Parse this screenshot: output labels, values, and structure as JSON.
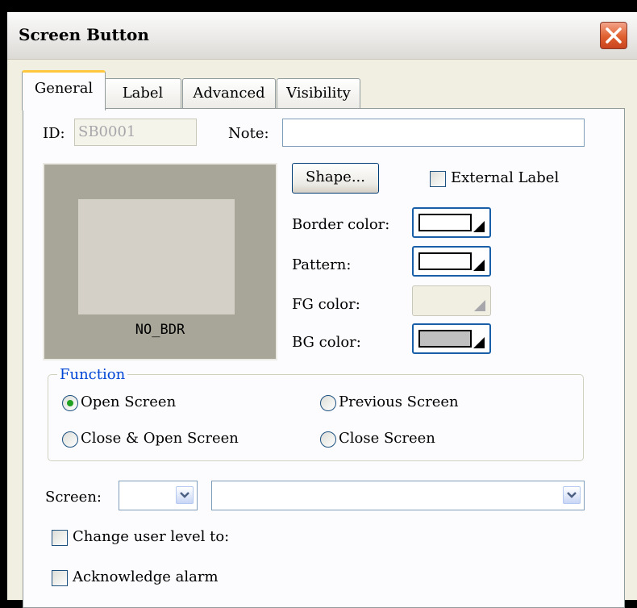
{
  "window": {
    "title": "Screen Button"
  },
  "tabs": [
    {
      "label": "General",
      "active": true
    },
    {
      "label": "Label",
      "active": false
    },
    {
      "label": "Advanced",
      "active": false
    },
    {
      "label": "Visibility",
      "active": false
    }
  ],
  "general": {
    "id_label": "ID:",
    "id_value": "SB0001",
    "note_label": "Note:",
    "note_value": "",
    "preview_label": "NO_BDR",
    "shape_button": "Shape...",
    "external_label": "External Label",
    "external_label_checked": false,
    "border_color_label": "Border color:",
    "pattern_label": "Pattern:",
    "fg_color_label": "FG color:",
    "bg_color_label": "BG color:",
    "colors": {
      "border": "#ffffff",
      "pattern": "#ffffff",
      "bg": "#c0c0c0"
    }
  },
  "function": {
    "legend": "Function",
    "options": [
      {
        "label": "Open Screen",
        "selected": true
      },
      {
        "label": "Previous Screen",
        "selected": false
      },
      {
        "label": "Close & Open Screen",
        "selected": false
      },
      {
        "label": "Close Screen",
        "selected": false
      }
    ]
  },
  "screen": {
    "label": "Screen:",
    "number_value": "",
    "name_value": ""
  },
  "options": {
    "change_user_level": "Change user level to:",
    "change_user_level_checked": false,
    "acknowledge_alarm": "Acknowledge alarm",
    "acknowledge_alarm_checked": false
  }
}
